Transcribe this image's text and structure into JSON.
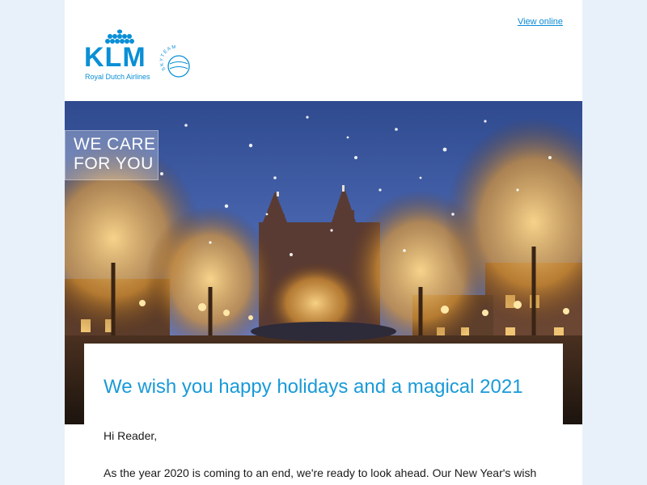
{
  "header": {
    "view_online_label": "View online"
  },
  "logo": {
    "wordmark": "KLM",
    "subtitle": "Royal Dutch Airlines",
    "alliance": "SKYTEAM"
  },
  "hero": {
    "badge_line1": "WE CARE",
    "badge_line2": "FOR YOU",
    "description_icon": "snowy-amsterdam-canal-photo"
  },
  "content": {
    "headline": "We wish you happy holidays and a magical 2021",
    "greeting": "Hi Reader,",
    "paragraph": "As the year 2020 is coming to an end, we're ready to look ahead. Our New Year's wish is"
  },
  "colors": {
    "brand_blue": "#0a8fd6",
    "headline_blue": "#1a9ad8",
    "page_background": "#e8f1fa"
  }
}
